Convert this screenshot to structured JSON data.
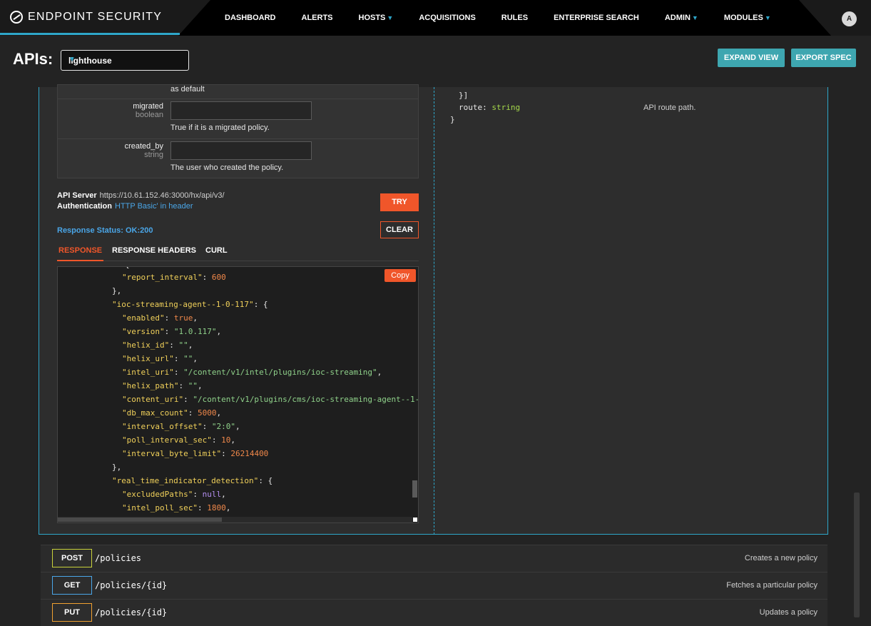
{
  "brand": {
    "name": "ENDPOINT SECURITY"
  },
  "nav": {
    "items": [
      {
        "label": "DASHBOARD",
        "dropdown": false
      },
      {
        "label": "ALERTS",
        "dropdown": false
      },
      {
        "label": "HOSTS",
        "dropdown": true
      },
      {
        "label": "ACQUISITIONS",
        "dropdown": false
      },
      {
        "label": "RULES",
        "dropdown": false
      },
      {
        "label": "ENTERPRISE SEARCH",
        "dropdown": false
      },
      {
        "label": "ADMIN",
        "dropdown": true
      },
      {
        "label": "MODULES",
        "dropdown": true
      }
    ],
    "avatar": "A"
  },
  "apis": {
    "label": "APIs:",
    "selected": "lighthouse",
    "expand_view": "EXPAND VIEW",
    "export_spec": "EXPORT SPEC"
  },
  "params": {
    "truncated_desc": "as default",
    "rows": [
      {
        "name": "migrated",
        "type": "boolean",
        "desc": "True if it is a migrated policy."
      },
      {
        "name": "created_by",
        "type": "string",
        "desc": "The user who created the policy."
      }
    ]
  },
  "server": {
    "api_server_label": "API Server",
    "api_server_url": "https://10.61.152.46:3000/hx/api/v3/",
    "auth_label": "Authentication",
    "auth_value": "HTTP Basic' in header",
    "try": "TRY",
    "clear": "CLEAR",
    "status": "Response Status: OK:200"
  },
  "tabs": [
    "RESPONSE",
    "RESPONSE HEADERS",
    "CURL"
  ],
  "copy_label": "Copy",
  "schema": {
    "close_array": "}]",
    "route_key": "route",
    "route_type": "string",
    "route_desc": "API route path.",
    "close_obj": "}"
  },
  "endpoints": [
    {
      "method": "POST",
      "path": "/policies",
      "desc": "Creates a new policy",
      "color": "#c9d23a"
    },
    {
      "method": "GET",
      "path": "/policies/{id}",
      "desc": "Fetches a particular policy",
      "color": "#4aa6e8"
    },
    {
      "method": "PUT",
      "path": "/policies/{id}",
      "desc": "Updates a policy",
      "color": "#f0a030"
    }
  ],
  "colors": {
    "accent": "#2ea6c9",
    "orange": "#f0562a",
    "teal": "#3ea6b0"
  }
}
